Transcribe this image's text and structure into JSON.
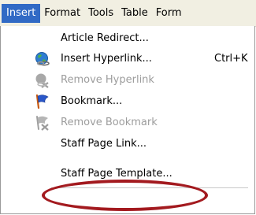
{
  "menubar": {
    "items": [
      {
        "label": "Insert"
      },
      {
        "label": "Format"
      },
      {
        "label": "Tools"
      },
      {
        "label": "Table"
      },
      {
        "label": "Form"
      }
    ]
  },
  "menu": {
    "article_redirect": {
      "label": "Article Redirect..."
    },
    "insert_hyperlink": {
      "label": "Insert Hyperlink...",
      "shortcut": "Ctrl+K",
      "icon": "globe-link-icon"
    },
    "remove_hyperlink": {
      "label": "Remove Hyperlink",
      "icon": "broken-link-icon",
      "disabled": true
    },
    "bookmark": {
      "label": "Bookmark...",
      "icon": "bookmark-flag-icon"
    },
    "remove_bookmark": {
      "label": "Remove Bookmark",
      "icon": "remove-bookmark-icon",
      "disabled": true
    },
    "staff_page_link": {
      "label": "Staff Page Link..."
    },
    "staff_page_template": {
      "label": "Staff Page Template..."
    }
  },
  "colors": {
    "highlight": "#316ac5",
    "annotation": "#a31a1f",
    "disabled_text": "#9d9d9d"
  }
}
